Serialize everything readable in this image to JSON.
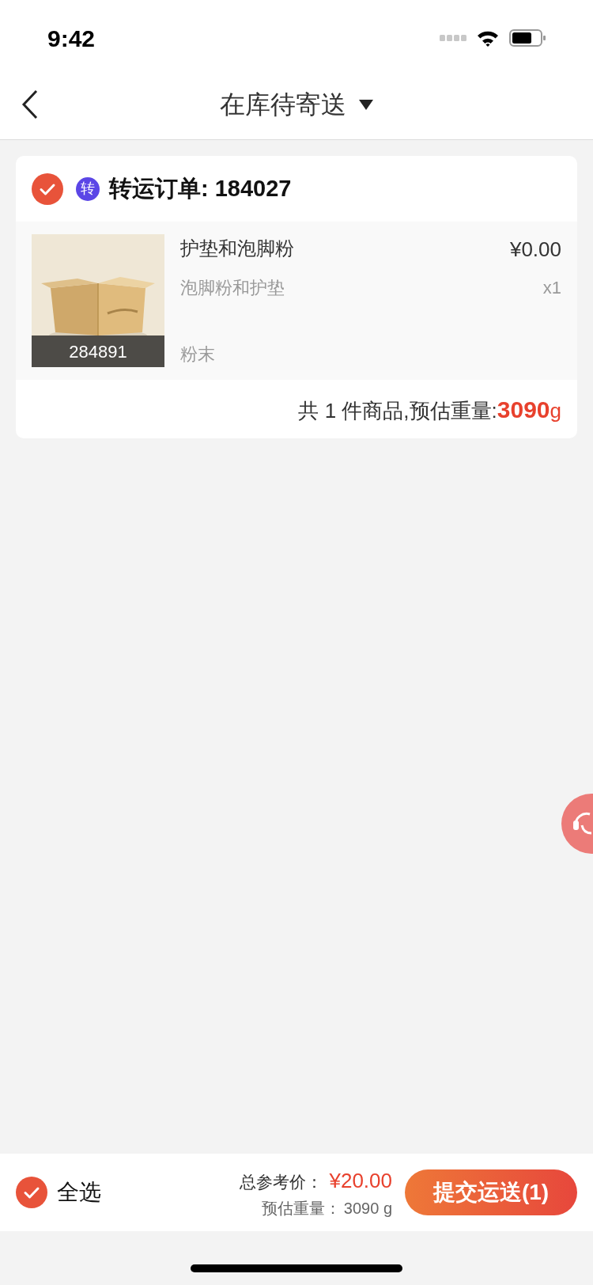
{
  "status_bar": {
    "time": "9:42"
  },
  "nav": {
    "title": "在库待寄送"
  },
  "orders": [
    {
      "checked": true,
      "badge": "转",
      "title": "转运订单: 184027",
      "items": [
        {
          "code": "284891",
          "name": "护垫和泡脚粉",
          "description": "泡脚粉和护垫",
          "spec": "粉末",
          "price": "¥0.00",
          "quantity": "x1"
        }
      ],
      "summary": "共 1 件商品,预估重量:",
      "weight": "3090",
      "unit": "g"
    }
  ],
  "footer": {
    "select_all": {
      "label": "全选",
      "checked": true
    },
    "total_label": "总参考价：",
    "total": "¥20.00",
    "weight_label": "预估重量：",
    "weight": "3090 g",
    "submit": "提交运送(1)"
  }
}
